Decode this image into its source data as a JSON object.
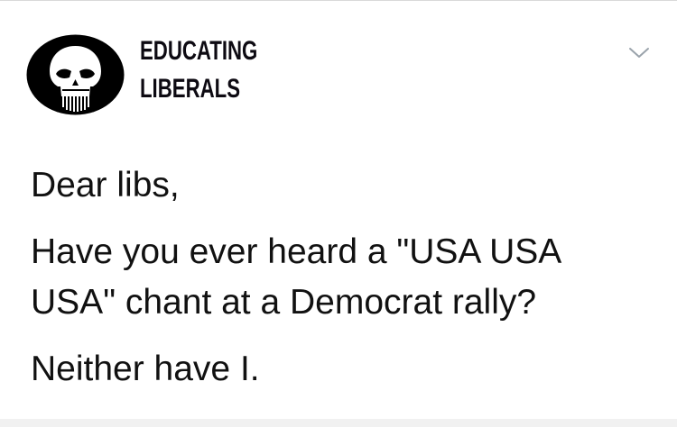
{
  "header": {
    "account_line1": "EDUCATING",
    "account_line2": "LIBERALS",
    "avatar_icon": "punisher-skull-icon",
    "menu_icon": "chevron-down-icon"
  },
  "tweet": {
    "line1": "Dear libs,",
    "line2a": "Have you ever heard a \"USA USA",
    "line2b": "USA\" chant at a Democrat rally?",
    "line3": "Neither have I."
  },
  "colors": {
    "text": "#111111",
    "avatar_bg": "#000000",
    "chevron": "#9aa3ab"
  }
}
